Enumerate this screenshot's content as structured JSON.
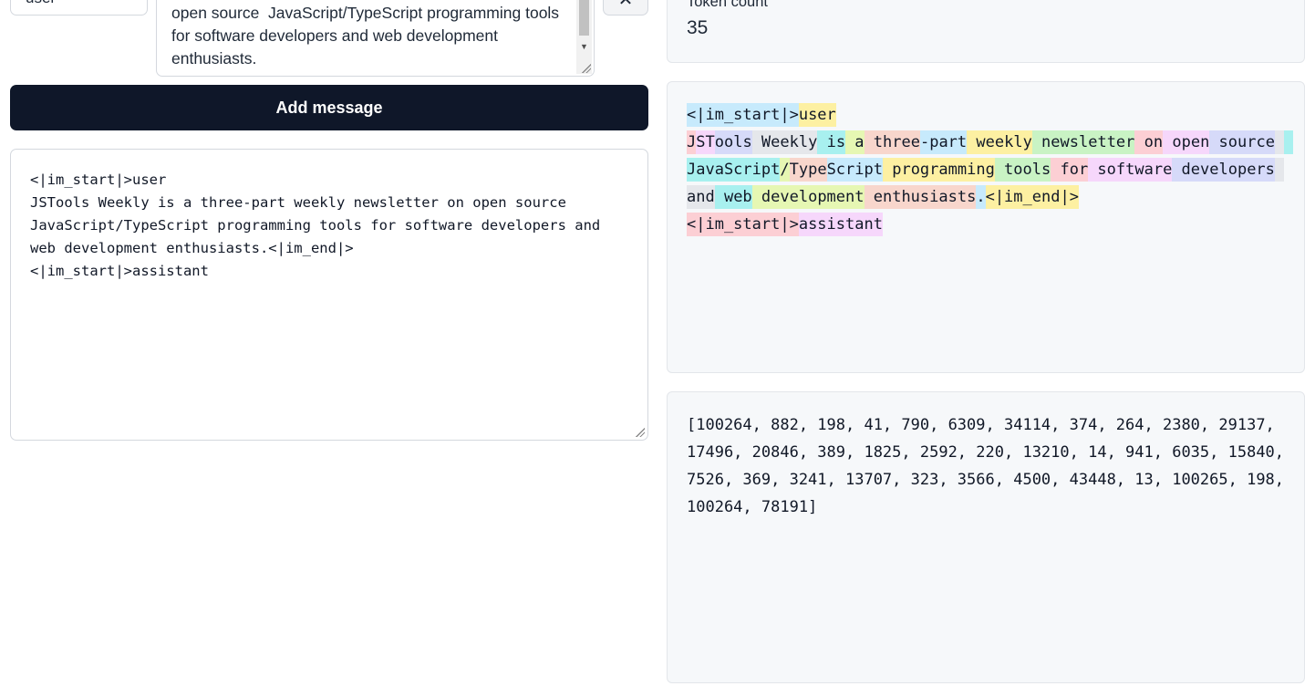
{
  "message": {
    "role": "user",
    "content": "open source  JavaScript/TypeScript programming tools for software developers and web development enthusiasts.",
    "remove_icon": "x-icon"
  },
  "add_button_label": "Add message",
  "prompt": "<|im_start|>user\nJSTools Weekly is a three-part weekly newsletter on open source JavaScript/TypeScript programming tools for software developers and web development enthusiasts.<|im_end|>\n<|im_start|>assistant",
  "token_count": {
    "label": "Token count",
    "value": "35"
  },
  "token_palette": [
    "#c7eafc",
    "#fdf0a2",
    "#c9f3c4",
    "#fccfd4",
    "#f6d7fb",
    "#d6daf9",
    "#e5e7eb",
    "#a8f0ef",
    "#e6f7b3",
    "#f8d6cc"
  ],
  "tokens": [
    "<|im_start|>",
    "user",
    "\n",
    "J",
    "ST",
    "ools",
    " Weekly",
    " is",
    " a",
    " three",
    "-part",
    " weekly",
    " newsletter",
    " on",
    " open",
    " source",
    " ",
    " JavaScript",
    "/",
    "Type",
    "Script",
    " programming",
    " tools",
    " for",
    " software",
    " developers",
    " and",
    " web",
    " development",
    " enthusiasts",
    ".",
    "<|im_end|>",
    "\n",
    "<|im_start|>",
    "assistant"
  ],
  "token_ids_text": "[100264, 882, 198, 41, 790, 6309, 34114, 374, 264, 2380, 29137, 17496, 20846, 389, 1825, 2592, 220, 13210, 14, 941, 6035, 15840, 7526, 369, 3241, 13707, 323, 3566, 4500, 43448, 13, 100265, 198, 100264, 78191]"
}
